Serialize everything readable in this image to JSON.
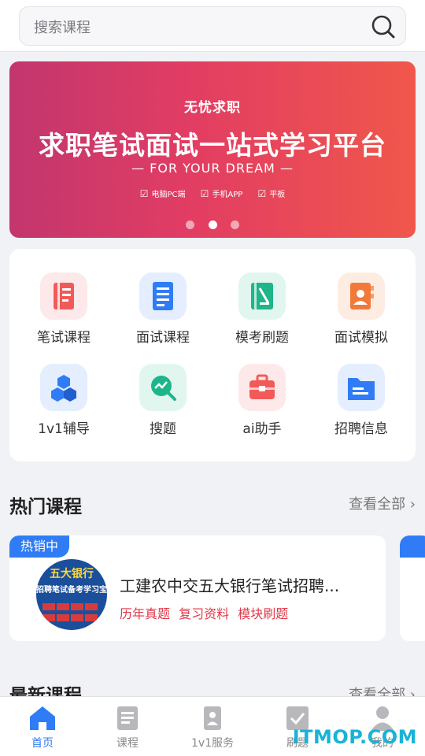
{
  "search": {
    "placeholder": "搜索课程"
  },
  "banner": {
    "brand": "无忧求职",
    "title": "求职笔试面试一站式学习平台",
    "slogan": "— FOR YOUR DREAM —",
    "tags": [
      "电脑PC端",
      "手机APP",
      "平板"
    ],
    "active_slide": 2,
    "slide_count": 3
  },
  "features": [
    {
      "label": "笔试课程",
      "icon": "notebook-icon",
      "color": "#f25a5a",
      "bg": "#fde9e9"
    },
    {
      "label": "面试课程",
      "icon": "document-icon",
      "color": "#2f7cf6",
      "bg": "#e4eefe"
    },
    {
      "label": "模考刷题",
      "icon": "exam-book-icon",
      "color": "#1fb58a",
      "bg": "#e1f6ee"
    },
    {
      "label": "面试模拟",
      "icon": "contact-book-icon",
      "color": "#f2793a",
      "bg": "#fdece2"
    },
    {
      "label": "1v1辅导",
      "icon": "cubes-icon",
      "color": "#2f7cf6",
      "bg": "#e4eefe"
    },
    {
      "label": "搜题",
      "icon": "search-chart-icon",
      "color": "#1fb58a",
      "bg": "#e1f6ee"
    },
    {
      "label": "ai助手",
      "icon": "toolbox-icon",
      "color": "#f25a5a",
      "bg": "#fde9e9"
    },
    {
      "label": "招聘信息",
      "icon": "folder-icon",
      "color": "#2f7cf6",
      "bg": "#e4eefe"
    }
  ],
  "hot": {
    "title": "热门课程",
    "see_all": "查看全部 ›",
    "badge": "热销中",
    "course": {
      "thumb_title": "五大银行",
      "thumb_sub": "招聘笔试备考学习宝典",
      "title": "工建农中交五大银行笔试招聘...",
      "tags": [
        "历年真题",
        "复习资料",
        "模块刷题"
      ]
    }
  },
  "latest": {
    "title": "最新课程",
    "see_all": "查看全部 ›"
  },
  "tabbar": [
    {
      "label": "首页",
      "icon": "home-icon",
      "active": true
    },
    {
      "label": "课程",
      "icon": "course-icon",
      "active": false
    },
    {
      "label": "1v1服务",
      "icon": "tutor-icon",
      "active": false
    },
    {
      "label": "刷题",
      "icon": "practice-icon",
      "active": false
    },
    {
      "label": "我的",
      "icon": "profile-icon",
      "active": false
    }
  ],
  "watermark": "ITMOP.COM"
}
